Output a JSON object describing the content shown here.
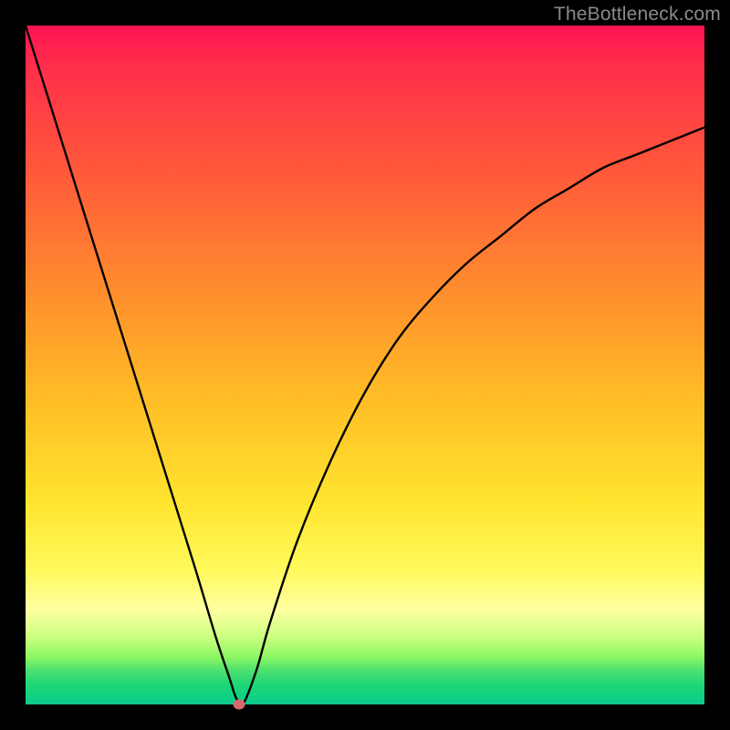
{
  "watermark": "TheBottleneck.com",
  "chart_data": {
    "type": "line",
    "title": "",
    "xlabel": "",
    "ylabel": "",
    "xlim": [
      0,
      100
    ],
    "ylim": [
      0,
      100
    ],
    "grid": false,
    "legend": false,
    "series": [
      {
        "name": "bottleneck-curve",
        "x": [
          0,
          5,
          10,
          15,
          20,
          25,
          28,
          30,
          31,
          32,
          34,
          36,
          40,
          45,
          50,
          55,
          60,
          65,
          70,
          75,
          80,
          85,
          90,
          95,
          100
        ],
        "y": [
          100,
          84,
          68,
          52,
          36,
          20,
          10,
          4,
          1,
          0,
          5,
          12,
          24,
          36,
          46,
          54,
          60,
          65,
          69,
          73,
          76,
          79,
          81,
          83,
          85
        ]
      }
    ],
    "marker": {
      "x": 31.5,
      "y": 0,
      "color": "#d66a6a"
    },
    "background_gradient": {
      "stops": [
        {
          "pos": 0.0,
          "color": "#ff1452"
        },
        {
          "pos": 0.22,
          "color": "#ff5a3a"
        },
        {
          "pos": 0.54,
          "color": "#ffba26"
        },
        {
          "pos": 0.8,
          "color": "#fff95a"
        },
        {
          "pos": 0.93,
          "color": "#8cf763"
        },
        {
          "pos": 1.0,
          "color": "#0cc88c"
        }
      ]
    }
  }
}
